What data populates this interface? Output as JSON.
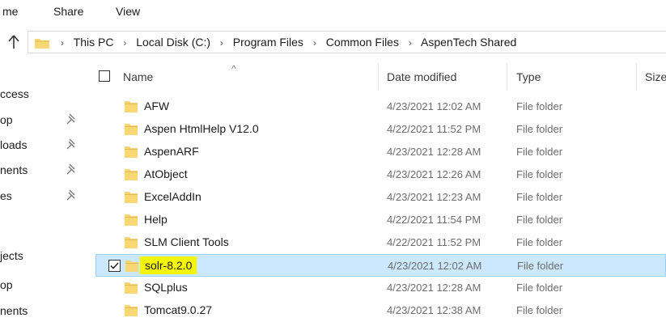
{
  "ribbon": {
    "tabs": [
      "me",
      "Share",
      "View"
    ]
  },
  "address": {
    "crumbs": [
      "This PC",
      "Local Disk (C:)",
      "Program Files",
      "Common Files",
      "AspenTech Shared"
    ]
  },
  "nav": {
    "items": [
      {
        "label": "ccess",
        "pinned": false
      },
      {
        "label": "op",
        "pinned": true
      },
      {
        "label": "loads",
        "pinned": true
      },
      {
        "label": "nents",
        "pinned": true
      },
      {
        "label": "es",
        "pinned": true
      },
      {
        "label": "jects",
        "pinned": false
      },
      {
        "label": "op",
        "pinned": false
      },
      {
        "label": "nents",
        "pinned": false
      }
    ]
  },
  "columns": {
    "name": "Name",
    "date": "Date modified",
    "type": "Type",
    "size": "Size"
  },
  "files": [
    {
      "name": "AFW",
      "date": "4/23/2021 12:02 AM",
      "type": "File folder",
      "selected": false
    },
    {
      "name": "Aspen HtmlHelp V12.0",
      "date": "4/22/2021 11:52 PM",
      "type": "File folder",
      "selected": false
    },
    {
      "name": "AspenARF",
      "date": "4/23/2021 12:28 AM",
      "type": "File folder",
      "selected": false
    },
    {
      "name": "AtObject",
      "date": "4/23/2021 12:26 AM",
      "type": "File folder",
      "selected": false
    },
    {
      "name": "ExcelAddIn",
      "date": "4/23/2021 12:23 AM",
      "type": "File folder",
      "selected": false
    },
    {
      "name": "Help",
      "date": "4/22/2021 11:54 PM",
      "type": "File folder",
      "selected": false
    },
    {
      "name": "SLM Client Tools",
      "date": "4/22/2021 11:52 PM",
      "type": "File folder",
      "selected": false
    },
    {
      "name": "solr-8.2.0",
      "date": "4/23/2021 12:02 AM",
      "type": "File folder",
      "selected": true
    },
    {
      "name": "SQLplus",
      "date": "4/23/2021 12:28 AM",
      "type": "File folder",
      "selected": false
    },
    {
      "name": "Tomcat9.0.27",
      "date": "4/23/2021 12:38 AM",
      "type": "File folder",
      "selected": false
    }
  ],
  "colors": {
    "selection_bg": "#cce8ff",
    "selection_border": "#99d1ff",
    "highlight": "#f5f500",
    "folder": "#f8d775"
  },
  "icons": {
    "up": "up-arrow-icon",
    "folder": "folder-icon",
    "pin": "pin-icon",
    "breadcrumb_sep": "chevron-right-icon"
  }
}
